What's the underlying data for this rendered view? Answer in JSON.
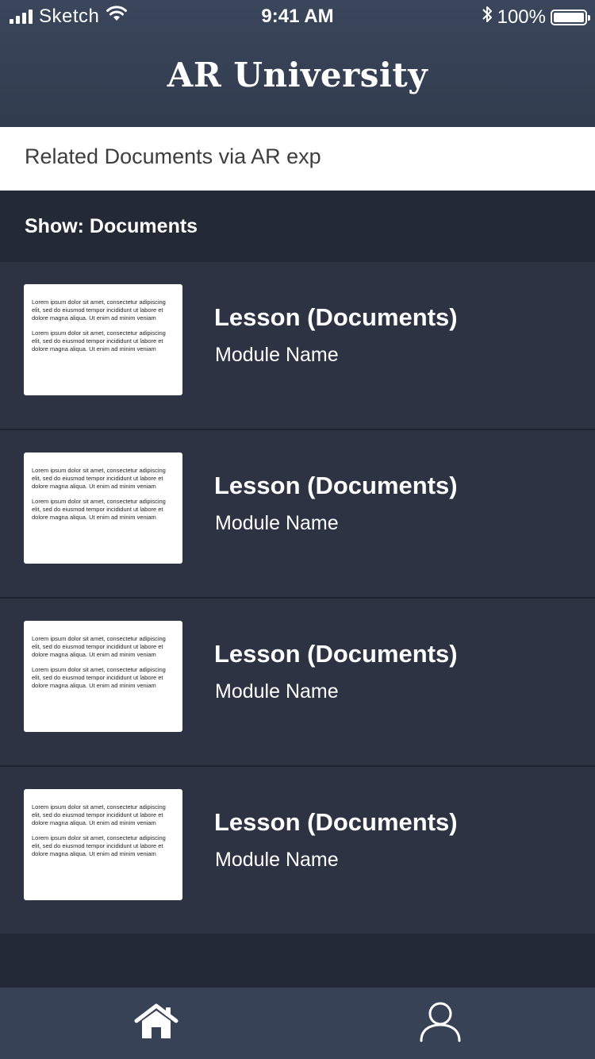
{
  "status_bar": {
    "carrier": "Sketch",
    "time": "9:41 AM",
    "battery": "100%",
    "icons": [
      "signal-icon",
      "wifi-icon",
      "bluetooth-icon",
      "battery-icon"
    ]
  },
  "header": {
    "title": "AR University"
  },
  "subheader": {
    "text": "Related Documents via AR exp"
  },
  "filter": {
    "label": "Show: Documents"
  },
  "lessons": [
    {
      "title": "Lesson (Documents)",
      "module": "Module Name",
      "thumb_paragraphs": [
        "Lorem ipsum dolor sit amet, consectetur adipiscing elit, sed do eiusmod tempor incididunt ut labore et dolore magna aliqua. Ut enim ad minim veniam",
        "Lorem ipsum dolor sit amet, consectetur adipiscing elit, sed do eiusmod tempor incididunt ut labore et dolore magna aliqua. Ut enim ad minim veniam"
      ]
    },
    {
      "title": "Lesson (Documents)",
      "module": "Module Name",
      "thumb_paragraphs": [
        "Lorem ipsum dolor sit amet, consectetur adipiscing elit, sed do eiusmod tempor incididunt ut labore et dolore magna aliqua. Ut enim ad minim veniam",
        "Lorem ipsum dolor sit amet, consectetur adipiscing elit, sed do eiusmod tempor incididunt ut labore et dolore magna aliqua. Ut enim ad minim veniam"
      ]
    },
    {
      "title": "Lesson (Documents)",
      "module": "Module Name",
      "thumb_paragraphs": [
        "Lorem ipsum dolor sit amet, consectetur adipiscing elit, sed do eiusmod tempor incididunt ut labore et dolore magna aliqua. Ut enim ad minim veniam",
        "Lorem ipsum dolor sit amet, consectetur adipiscing elit, sed do eiusmod tempor incididunt ut labore et dolore magna aliqua. Ut enim ad minim veniam"
      ]
    },
    {
      "title": "Lesson (Documents)",
      "module": "Module Name",
      "thumb_paragraphs": [
        "Lorem ipsum dolor sit amet, consectetur adipiscing elit, sed do eiusmod tempor incididunt ut labore et dolore magna aliqua. Ut enim ad minim veniam",
        "Lorem ipsum dolor sit amet, consectetur adipiscing elit, sed do eiusmod tempor incididunt ut labore et dolore magna aliqua. Ut enim ad minim veniam"
      ]
    }
  ],
  "tab_bar": {
    "tabs": [
      {
        "icon": "home-icon"
      },
      {
        "icon": "profile-icon"
      }
    ]
  },
  "colors": {
    "header_bg": "#3a465b",
    "subheader_bg": "#ffffff",
    "filter_bg": "#232935",
    "row_bg": "#2d3343",
    "tabbar_bg": "#384256",
    "text_light": "#ffffff",
    "text_dark": "#3e3e3e"
  }
}
